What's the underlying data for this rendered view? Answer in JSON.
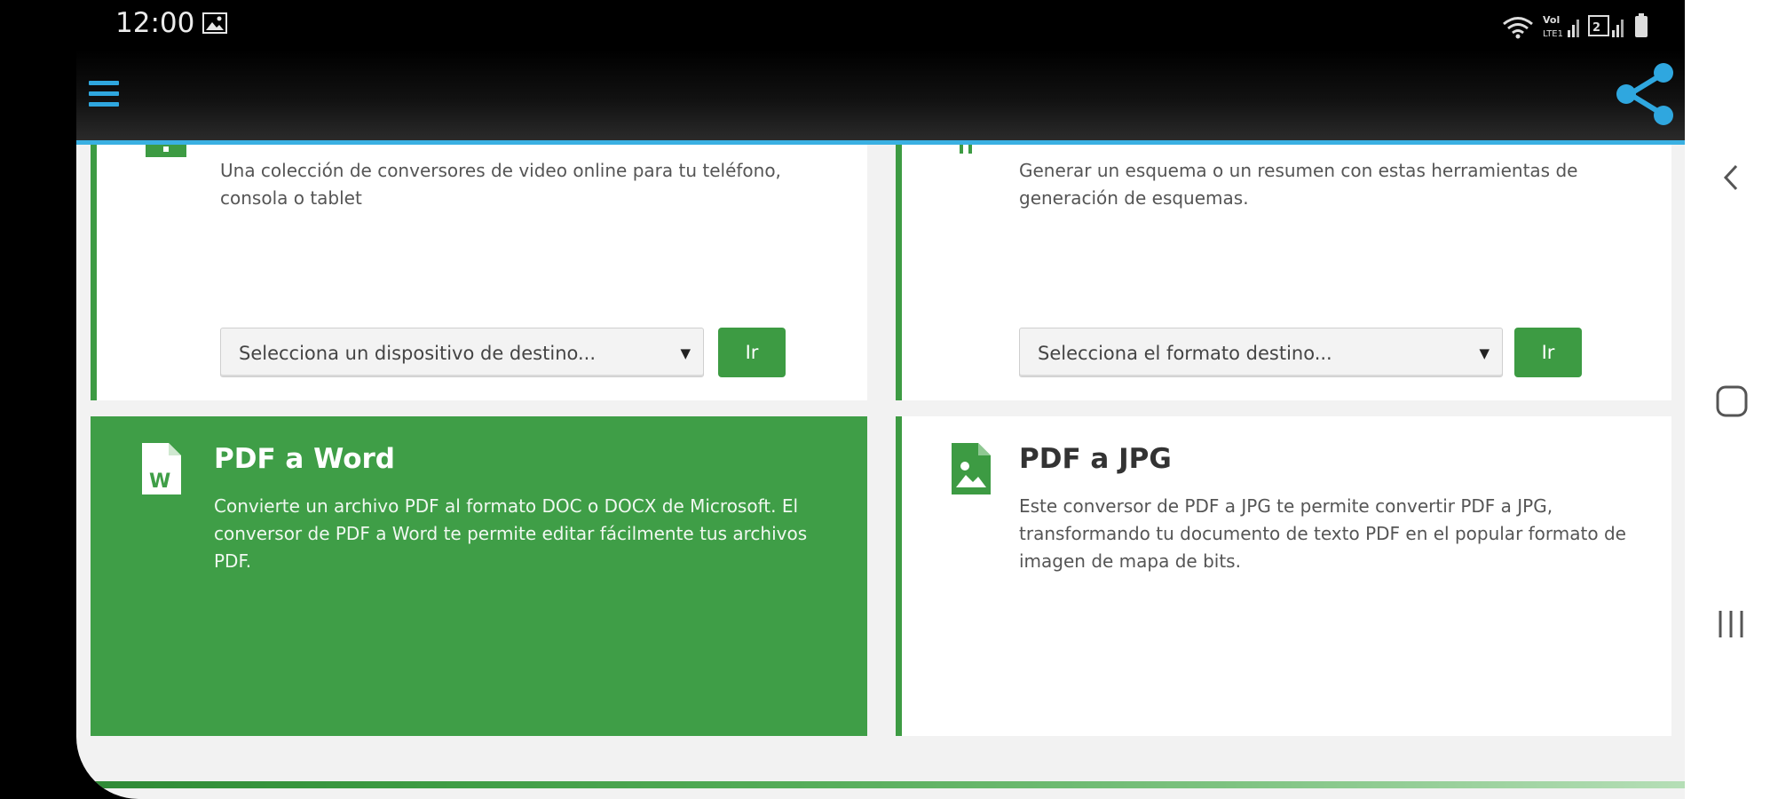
{
  "status_bar": {
    "time": "12:00",
    "icons": [
      "gallery-icon",
      "wifi-icon",
      "volte-signal-icon",
      "sim2-signal-icon",
      "battery-icon"
    ]
  },
  "app_bar": {
    "menu_icon": "hamburger-menu-icon",
    "share_icon": "share-icon",
    "accent_color": "#3ab0e2"
  },
  "cards": {
    "video": {
      "description": "Una colección de conversores de video online para tu teléfono, consola o tablet",
      "select_placeholder": "Selecciona un dispositivo de destino...",
      "button_label": "Ir"
    },
    "outline": {
      "description": "Generar un esquema o un resumen con estas herramientas de generación de esquemas.",
      "select_placeholder": "Selecciona el formato destino...",
      "button_label": "Ir"
    },
    "pdf_word": {
      "title": "PDF a Word",
      "description": "Convierte un archivo PDF al formato DOC o DOCX de Microsoft. El conversor de PDF a Word te permite editar fácilmente tus archivos PDF.",
      "icon": "word-document-icon",
      "icon_letter": "W"
    },
    "pdf_jpg": {
      "title": "PDF a JPG",
      "description": "Este conversor de PDF a JPG te permite convertir PDF a JPG, transformando tu documento de texto PDF en el popular formato de imagen de mapa de bits.",
      "icon": "image-file-icon"
    }
  },
  "colors": {
    "brand_green": "#3d9b43",
    "highlight_card": "#3f9e47"
  },
  "nav_bar": {
    "icons": [
      "back-icon",
      "home-icon",
      "recent-apps-icon"
    ]
  }
}
